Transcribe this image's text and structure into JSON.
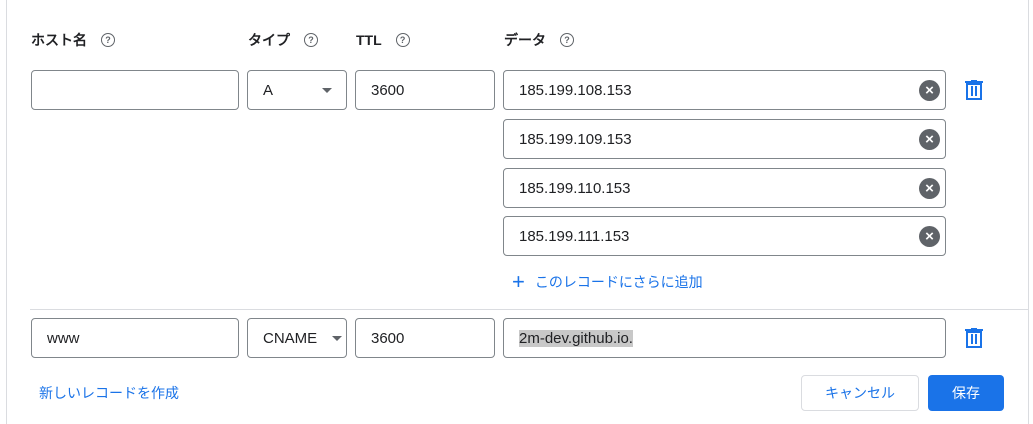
{
  "headers": {
    "hostname": "ホスト名",
    "type": "タイプ",
    "ttl": "TTL",
    "data": "データ",
    "help_glyph": "?"
  },
  "records": [
    {
      "hostname": "",
      "type": "A",
      "ttl": "3600",
      "data": [
        "185.199.108.153",
        "185.199.109.153",
        "185.199.110.153",
        "185.199.111.153"
      ],
      "add_more_label": "このレコードにさらに追加"
    },
    {
      "hostname": "www",
      "type": "CNAME",
      "ttl": "3600",
      "data": [
        "2m-dev.github.io."
      ]
    }
  ],
  "actions": {
    "create_new": "新しいレコードを作成",
    "cancel": "キャンセル",
    "save": "保存"
  },
  "icons": {
    "help": "help-circle-icon",
    "clear": "clear-circle-icon",
    "delete": "trash-icon",
    "dropdown": "dropdown-arrow-icon",
    "add": "plus-icon"
  },
  "colors": {
    "accent": "#1a73e8",
    "border": "#80868b",
    "divider": "#dadce0",
    "icon": "#5f6368"
  }
}
